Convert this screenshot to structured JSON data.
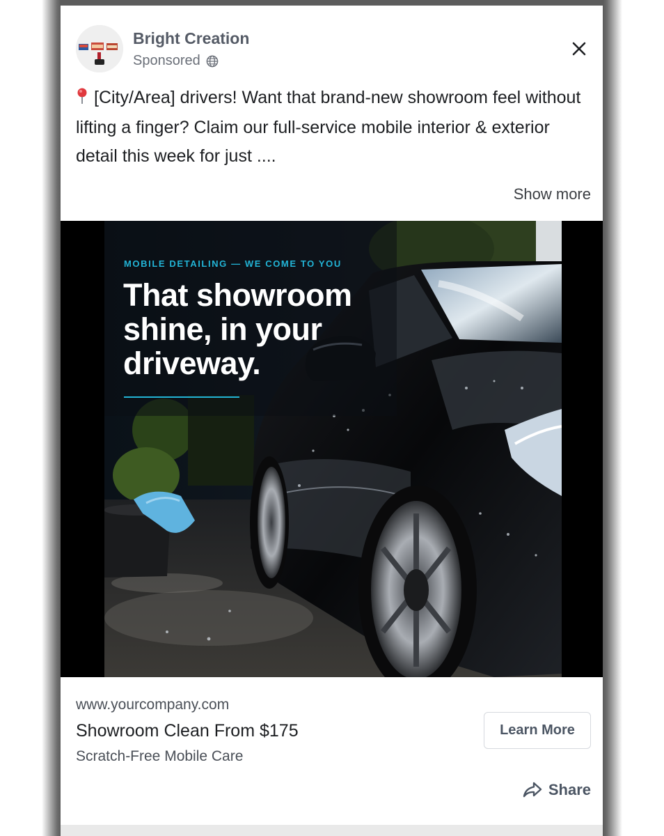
{
  "post": {
    "advertiser_name": "Bright Creation",
    "sponsored_label": "Sponsored",
    "audience_icon": "globe-icon",
    "close_icon": "close-icon",
    "pin_emoji": "📍",
    "body_text": "[City/Area] drivers! Want that brand-new showroom feel without lifting a finger? Claim our full-service mobile interior & exterior detail this week for just ....",
    "show_more_label": "Show more"
  },
  "creative": {
    "eyebrow": "MOBILE DETAILING — WE COME TO YOU",
    "headline": "That showroom shine, in your driveway.",
    "accent_color": "#22b4d6"
  },
  "link": {
    "url": "www.yourcompany.com",
    "title": "Showroom Clean From $175",
    "description": "Scratch-Free Mobile Care",
    "cta_label": "Learn More"
  },
  "actions": {
    "share_label": "Share",
    "share_icon": "share-icon"
  }
}
